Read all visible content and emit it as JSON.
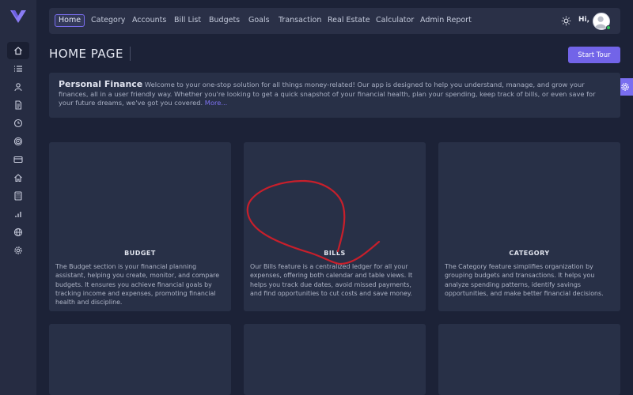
{
  "colors": {
    "background": "#1c2237",
    "sidebar": "#262c42",
    "panel": "#283047",
    "accent": "#7264e8",
    "online": "#2fc45a",
    "annotation": "#c81f2b"
  },
  "sidebar": {
    "icons": [
      "home-icon",
      "list-icon",
      "user-icon",
      "document-icon",
      "clock-icon",
      "target-icon",
      "card-icon",
      "house-icon",
      "calculator-icon",
      "bar-chart-icon",
      "globe-icon",
      "gear-icon"
    ]
  },
  "nav": {
    "items": [
      "Home",
      "Category",
      "Accounts",
      "Bill List",
      "Budgets",
      "Goals",
      "Transaction",
      "Real Estate",
      "Calculator",
      "Admin Report"
    ],
    "greeting": "Hi,"
  },
  "page": {
    "title": "HOME PAGE",
    "tour_button": "Start Tour"
  },
  "intro": {
    "title": "Personal Finance",
    "text": " Welcome to your one-stop solution for all things money-related! Our app is designed to help you understand, manage, and grow your finances, all in a user friendly way. Whether you're looking to get a quick snapshot of your financial health, plan your spending, keep track of bills, or even save for your future dreams, we've got you covered. ",
    "more": "More..."
  },
  "cards": [
    {
      "title": "BUDGET",
      "text": "The Budget section is your financial planning assistant, helping you create, monitor, and compare budgets. It ensures you achieve financial goals by tracking income and expenses, promoting financial health and discipline."
    },
    {
      "title": "BILLS",
      "text": "Our Bills feature is a centralized ledger for all your expenses, offering both calendar and table views. It helps you track due dates, avoid missed payments, and find opportunities to cut costs and save money."
    },
    {
      "title": "CATEGORY",
      "text": "The Category feature simplifies organization by grouping budgets and transactions. It helps you analyze spending patterns, identify savings opportunities, and make better financial decisions."
    }
  ]
}
